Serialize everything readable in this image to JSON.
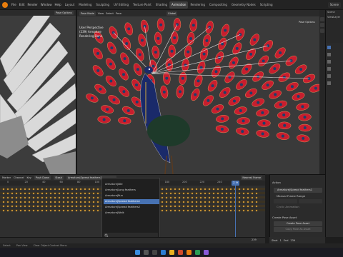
{
  "menubar": {
    "menus": [
      "File",
      "Edit",
      "Render",
      "Window",
      "Help"
    ],
    "workspaces": [
      "Layout",
      "Modeling",
      "Sculpting",
      "UV Editing",
      "Texture Paint",
      "Shading",
      "Animation",
      "Rendering",
      "Compositing",
      "Geometry Nodes",
      "Scripting"
    ],
    "active_workspace": "Animation",
    "scene": "Scene",
    "view_layer": "ViewLayer"
  },
  "left_editor": {
    "label": "Pose Options"
  },
  "viewport": {
    "mode": "Pose Mode",
    "view_menu": "View",
    "select_menu": "Select",
    "pose_menu": "Pose",
    "orientation": "Global",
    "info": {
      "line1": "User Perspective",
      "line2": "(239) Armature",
      "line3": "Rendering Done"
    },
    "pose_options": "Pose Options"
  },
  "timeline": {
    "menus": [
      "Marker",
      "Channel",
      "Key"
    ],
    "push_down": "Push Down",
    "stash": "Stash",
    "action_name": "Armature|Spread feathers1",
    "ruler_ticks": [
      "0",
      "20",
      "40",
      "60",
      "80",
      "100",
      "120",
      "140",
      "160",
      "180",
      "200",
      "220",
      "240",
      "260"
    ],
    "current_frame": "239",
    "nearest_frame": "Nearest Frame"
  },
  "bone_list": {
    "items": [
      "Armature|Idle",
      "Armature|Long feathers",
      "Armature|Run",
      "Armature|Spread feathers1",
      "Armature|Spread feathers2",
      "Armature|Walk"
    ],
    "selected_index": 3,
    "search_icon": "search-icon"
  },
  "action_panel": {
    "header": "Action",
    "action_field": "Armature|Spread feathers1",
    "manual_frame_range": "Manual Frame Range",
    "start_label": "Start",
    "end_label": "End",
    "cyclic_label": "Cyclic Animation",
    "create_pose_asset": "Create Pose Asset",
    "create_btn": "Create Pose Asset",
    "copy_btn": "Copy Pose As Asset",
    "start_value": "1",
    "end_value": "239"
  },
  "timeline_footer": {
    "start": "Start",
    "start_val": "1",
    "end": "End",
    "end_val": "239",
    "current": "239"
  },
  "statusbar": {
    "left": "Select",
    "middle": "Pan View",
    "right": "Clear Object Context Menu"
  },
  "colors": {
    "accent": "#e87d0d",
    "selection": "#4772b3",
    "feather_red": "#d42030"
  }
}
